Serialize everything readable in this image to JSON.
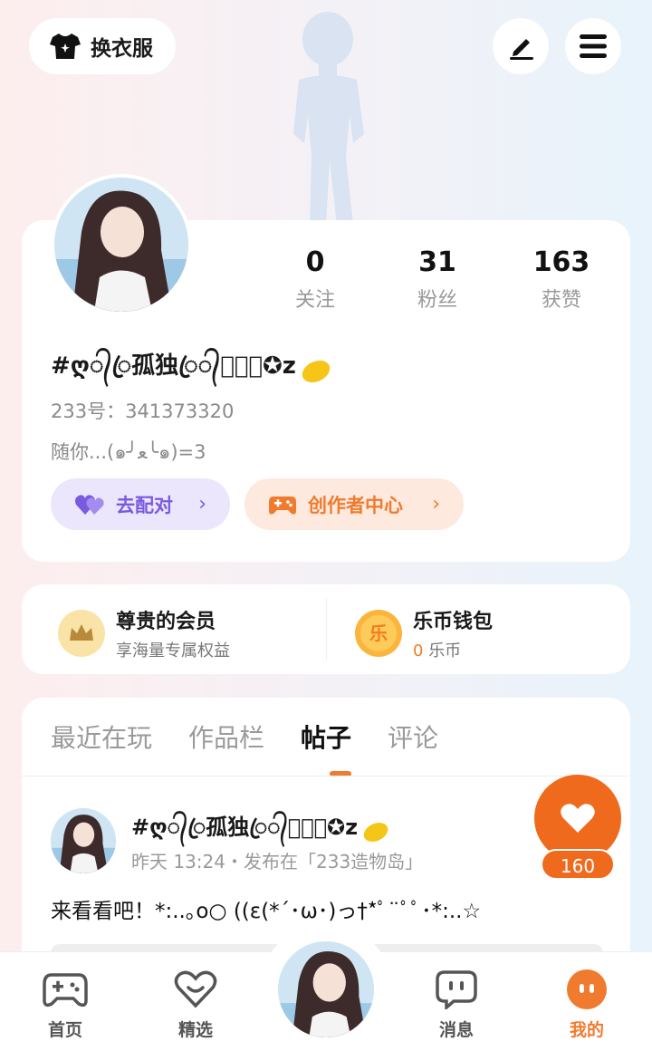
{
  "header": {
    "wardrobe_label": "换衣服",
    "edit_icon": "pencil-icon",
    "menu_icon": "hamburger-menu-icon"
  },
  "profile": {
    "stats": [
      {
        "value": "0",
        "label": "关注"
      },
      {
        "value": "31",
        "label": "粉丝"
      },
      {
        "value": "163",
        "label": "获赞"
      }
    ],
    "username": "#ღ᭄ꦿ孤独ꦿ᭄ঔৣ⃟✪z",
    "uid": "233号：341373320",
    "bio": "随你...(๑╯ﻌ╰๑)=3",
    "match_label": "去配对",
    "creator_label": "创作者中心"
  },
  "vip": {
    "member_title": "尊贵的会员",
    "member_sub": "享海量专属权益",
    "wallet_title": "乐币钱包",
    "wallet_balance": "0",
    "wallet_unit": "乐币",
    "coin_glyph": "乐"
  },
  "tabs": [
    "最近在玩",
    "作品栏",
    "帖子",
    "评论"
  ],
  "post": {
    "username": "#ღ᭄ꦿ孤独ꦿ᭄ঔৣ⃟✪z",
    "meta": "昨天 13:24・发布在「233造物岛」",
    "text": "来看看吧！*:..｡o○ ((ε(*´･ω･)っ†*ﾟ¨ﾟﾟ･*:..☆",
    "likes": "160"
  },
  "nav": [
    {
      "label": "首页",
      "icon": "gamepad-icon"
    },
    {
      "label": "精选",
      "icon": "heart-chat-icon"
    },
    {
      "label": "",
      "icon": "avatar-center"
    },
    {
      "label": "消息",
      "icon": "message-icon"
    },
    {
      "label": "我的",
      "icon": "profile-face-icon"
    }
  ],
  "colors": {
    "accent": "#f07b2e",
    "purple": "#7a5ae0"
  }
}
